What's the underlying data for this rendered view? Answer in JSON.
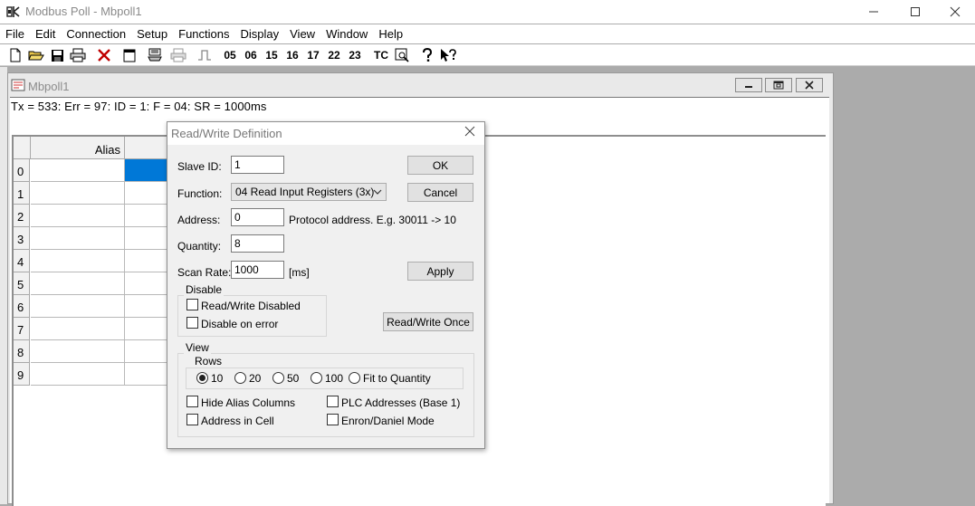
{
  "app": {
    "title": "Modbus Poll - Mbpoll1"
  },
  "menu": [
    "File",
    "Edit",
    "Connection",
    "Setup",
    "Functions",
    "Display",
    "View",
    "Window",
    "Help"
  ],
  "toolbar": {
    "function_codes": [
      "05",
      "06",
      "15",
      "16",
      "17",
      "22",
      "23"
    ],
    "tc_label": "TC"
  },
  "child": {
    "title": "Mbpoll1",
    "status": "Tx = 533: Err = 97: ID = 1: F = 04: SR = 1000ms",
    "grid": {
      "alias_header": "Alias",
      "rows": [
        "0",
        "1",
        "2",
        "3",
        "4",
        "5",
        "6",
        "7",
        "8",
        "9"
      ]
    }
  },
  "dialog": {
    "title": "Read/Write Definition",
    "slave_id": {
      "label": "Slave ID:",
      "value": "1"
    },
    "function": {
      "label": "Function:",
      "value": "04 Read Input Registers (3x)"
    },
    "address": {
      "label": "Address:",
      "value": "0",
      "hint": "Protocol address. E.g. 30011 -> 10"
    },
    "quantity": {
      "label": "Quantity:",
      "value": "8"
    },
    "scan_rate": {
      "label": "Scan Rate:",
      "value": "1000",
      "unit": "[ms]"
    },
    "buttons": {
      "ok": "OK",
      "cancel": "Cancel",
      "apply": "Apply",
      "rw_once": "Read/Write Once"
    },
    "disable": {
      "title": "Disable",
      "rw_disabled": "Read/Write Disabled",
      "disable_on_error": "Disable on error"
    },
    "view": {
      "title": "View",
      "rows_title": "Rows",
      "row_options": [
        "10",
        "20",
        "50",
        "100",
        "Fit to Quantity"
      ],
      "selected_row_option": "10",
      "hide_alias": "Hide Alias Columns",
      "address_in_cell": "Address in Cell",
      "plc_addresses": "PLC Addresses (Base 1)",
      "enron_mode": "Enron/Daniel Mode"
    }
  }
}
